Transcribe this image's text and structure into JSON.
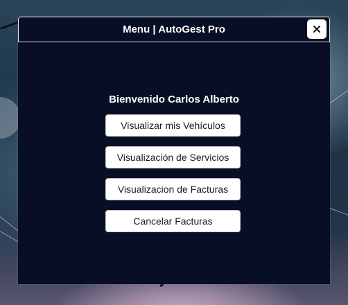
{
  "window": {
    "title": "Menu | AutoGest Pro",
    "close_icon": "close-icon"
  },
  "main": {
    "welcome": "Bienvenido Carlos Alberto",
    "buttons": [
      {
        "label": "Visualizar mis Vehículos"
      },
      {
        "label": "Visualización de Servicios"
      },
      {
        "label": "Visualizacion de Facturas"
      },
      {
        "label": "Cancelar Facturas"
      }
    ]
  },
  "colors": {
    "window_bg": "#070e26",
    "button_bg": "#ffffff",
    "title_text": "#ffffff"
  }
}
